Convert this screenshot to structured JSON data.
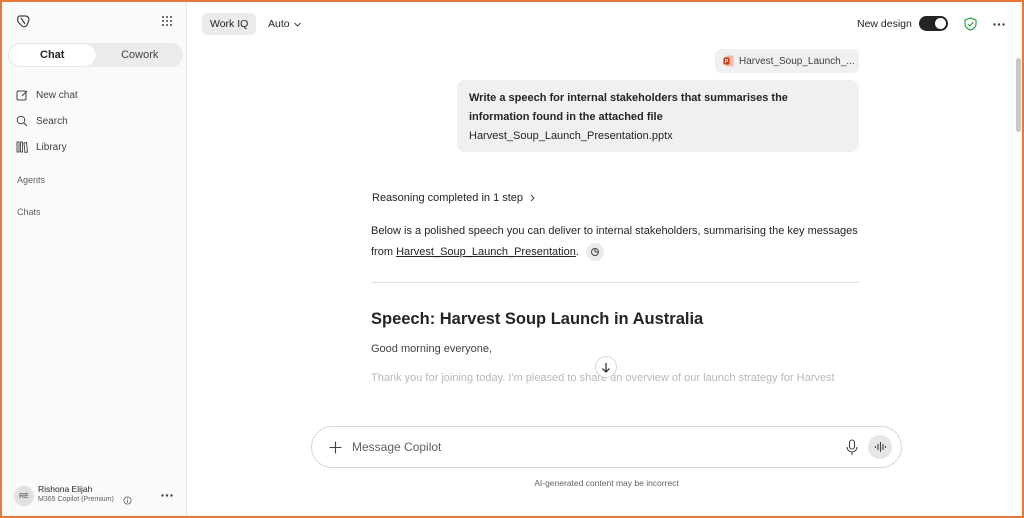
{
  "sidebar": {
    "tabs": [
      {
        "label": "Chat",
        "active": true
      },
      {
        "label": "Cowork",
        "active": false
      }
    ],
    "nav": [
      {
        "label": "New chat",
        "icon": "compose-icon"
      },
      {
        "label": "Search",
        "icon": "search-icon"
      },
      {
        "label": "Library",
        "icon": "library-icon"
      }
    ],
    "sections": {
      "agents": "Agents",
      "chats": "Chats"
    },
    "user": {
      "initials": "RE",
      "name": "Rishona Elijah",
      "plan": "M365 Copilot (Premium)"
    }
  },
  "topbar": {
    "workiq": "Work IQ",
    "model": "Auto",
    "new_design_label": "New design",
    "new_design_on": true
  },
  "conversation": {
    "attachment": "Harvest_Soup_Launch_...",
    "user_message": "Write a speech for internal stakeholders that summarises the information found in the attached file",
    "user_file": "Harvest_Soup_Launch_Presentation.pptx",
    "reasoning": "Reasoning completed in 1 step",
    "intro_before": "Below is a polished speech you can deliver to internal stakeholders, summarising the key messages from ",
    "intro_link": "Harvest_Soup_Launch_Presentation",
    "intro_after": ".",
    "speech_title": "Speech: Harvest Soup Launch in Australia",
    "greeting": "Good morning everyone,",
    "faded_line": "Thank you for joining today. I'm pleased to share an overview of our launch strategy for Harvest"
  },
  "composer": {
    "placeholder": "Message Copilot",
    "disclaimer": "AI-generated content may be incorrect"
  },
  "colors": {
    "frame": "#e8783a",
    "shield": "#2ea043",
    "pptx": "#c43e1c"
  }
}
